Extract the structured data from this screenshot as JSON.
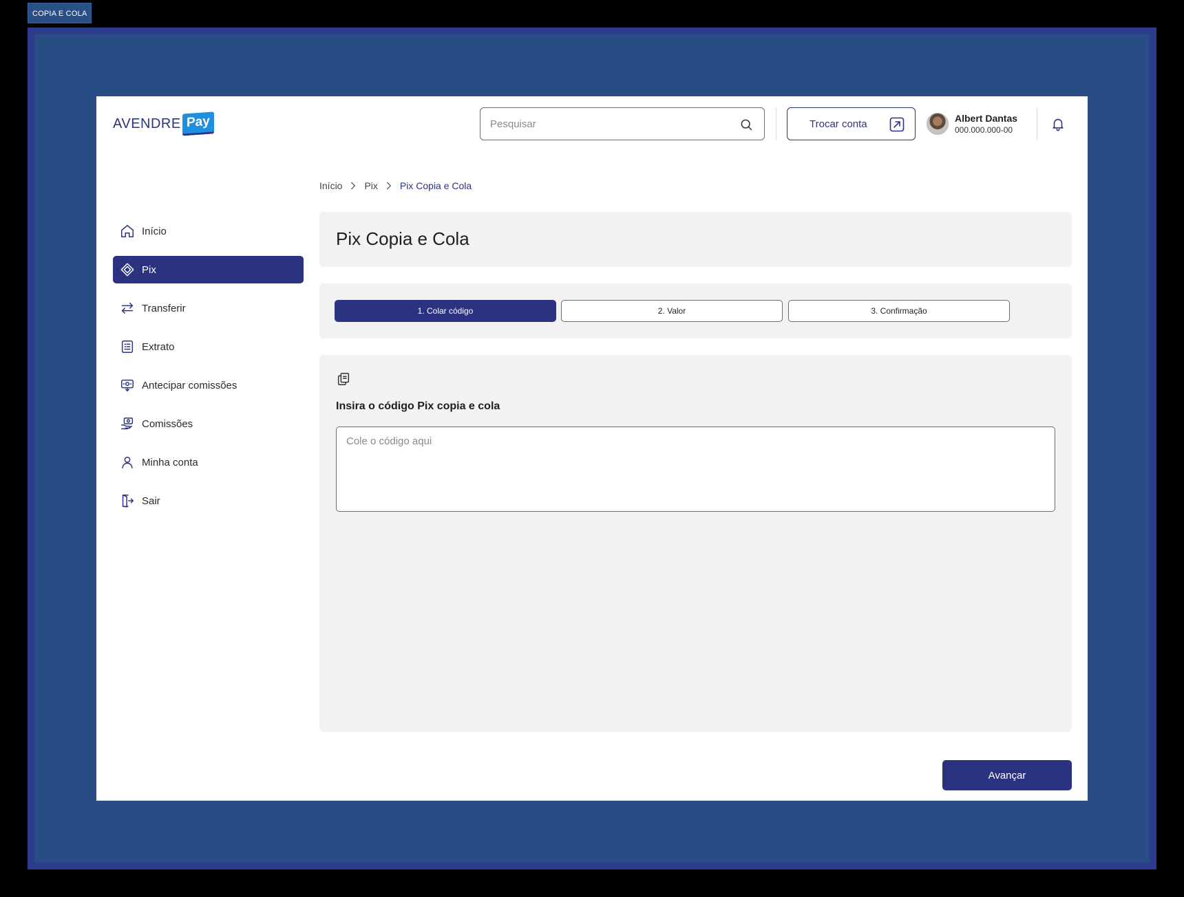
{
  "frame": {
    "label": "COPIA E COLA"
  },
  "header": {
    "logo_text": "AVENDRE",
    "logo_badge": "Pay",
    "search_placeholder": "Pesquisar",
    "switch_account_label": "Trocar conta",
    "user": {
      "name": "Albert Dantas",
      "document": "000.000.000-00"
    }
  },
  "sidebar": {
    "items": [
      {
        "label": "Início",
        "icon": "home-icon",
        "active": false
      },
      {
        "label": "Pix",
        "icon": "pix-icon",
        "active": true
      },
      {
        "label": "Transferir",
        "icon": "transfer-arrows-icon",
        "active": false
      },
      {
        "label": "Extrato",
        "icon": "statement-icon",
        "active": false
      },
      {
        "label": "Antecipar comissões",
        "icon": "advance-commission-icon",
        "active": false
      },
      {
        "label": "Comissões",
        "icon": "commissions-icon",
        "active": false
      },
      {
        "label": "Minha conta",
        "icon": "user-icon",
        "active": false
      },
      {
        "label": "Sair",
        "icon": "logout-icon",
        "active": false
      }
    ]
  },
  "breadcrumb": [
    "Início",
    "Pix",
    "Pix Copia e Cola"
  ],
  "page": {
    "title": "Pix Copia e Cola",
    "steps": [
      {
        "label": "1. Colar código",
        "active": true
      },
      {
        "label": "2. Valor",
        "active": false
      },
      {
        "label": "3. Confirmação",
        "active": false
      }
    ],
    "form": {
      "label": "Insira o código Pix copia e cola",
      "code_value": "",
      "code_placeholder": "Cole o código aqui"
    },
    "next_button": "Avançar"
  },
  "colors": {
    "primary": "#2b3381",
    "frame_bg": "#284d85",
    "panel_bg": "#f2f2f2",
    "logo_badge": "#1f8fe0"
  }
}
